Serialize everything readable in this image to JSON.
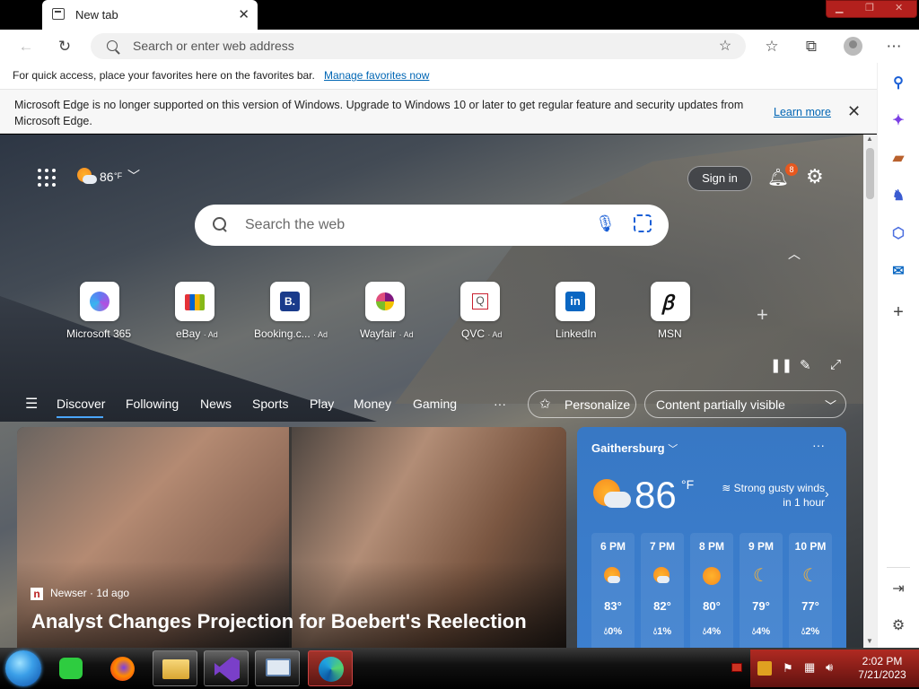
{
  "browser": {
    "tab_title": "New tab",
    "address_placeholder": "Search or enter web address"
  },
  "favbar": {
    "message": "For quick access, place your favorites here on the favorites bar.",
    "link": "Manage favorites now"
  },
  "infobar": {
    "message": "Microsoft Edge is no longer supported on this version of Windows. Upgrade to Windows 10 or later to get regular feature and security updates from Microsoft Edge.",
    "learn_more": "Learn more"
  },
  "header": {
    "weather_temp": "86",
    "weather_unit": "°F",
    "sign_in": "Sign in",
    "notification_count": "8"
  },
  "search": {
    "placeholder": "Search the web"
  },
  "quicklinks": [
    {
      "label": "Microsoft 365",
      "ad": ""
    },
    {
      "label": "eBay",
      "ad": "· Ad"
    },
    {
      "label": "Booking.c...",
      "ad": "· Ad"
    },
    {
      "label": "Wayfair",
      "ad": "· Ad"
    },
    {
      "label": "QVC",
      "ad": "· Ad"
    },
    {
      "label": "LinkedIn",
      "ad": ""
    },
    {
      "label": "MSN",
      "ad": ""
    }
  ],
  "nav": {
    "items": [
      "Discover",
      "Following",
      "News",
      "Sports",
      "Play",
      "Money",
      "Gaming"
    ],
    "more": "···",
    "personalize": "Personalize",
    "content_visibility": "Content partially visible"
  },
  "news": {
    "source": "Newser",
    "age": "· 1d ago",
    "headline": "Analyst Changes Projection for Boebert's Reelection"
  },
  "weather": {
    "city": "Gaithersburg",
    "temp": "86",
    "unit": "°F",
    "alert_line1": "Strong gusty winds",
    "alert_line2": "in 1 hour",
    "hourly": [
      {
        "time": "6 PM",
        "temp": "83°",
        "precip": "0%",
        "icon": "partly-sunny-icon"
      },
      {
        "time": "7 PM",
        "temp": "82°",
        "precip": "1%",
        "icon": "partly-sunny-icon"
      },
      {
        "time": "8 PM",
        "temp": "80°",
        "precip": "4%",
        "icon": "sun-icon"
      },
      {
        "time": "9 PM",
        "temp": "79°",
        "precip": "4%",
        "icon": "moon-icon"
      },
      {
        "time": "10 PM",
        "temp": "77°",
        "precip": "2%",
        "icon": "moon-icon"
      }
    ]
  },
  "taskbar": {
    "time": "2:02 PM",
    "date": "7/21/2023"
  },
  "colors": {
    "accent": "#0066b4",
    "weather_card": "#3878c4",
    "notification_badge": "#e6581f"
  }
}
